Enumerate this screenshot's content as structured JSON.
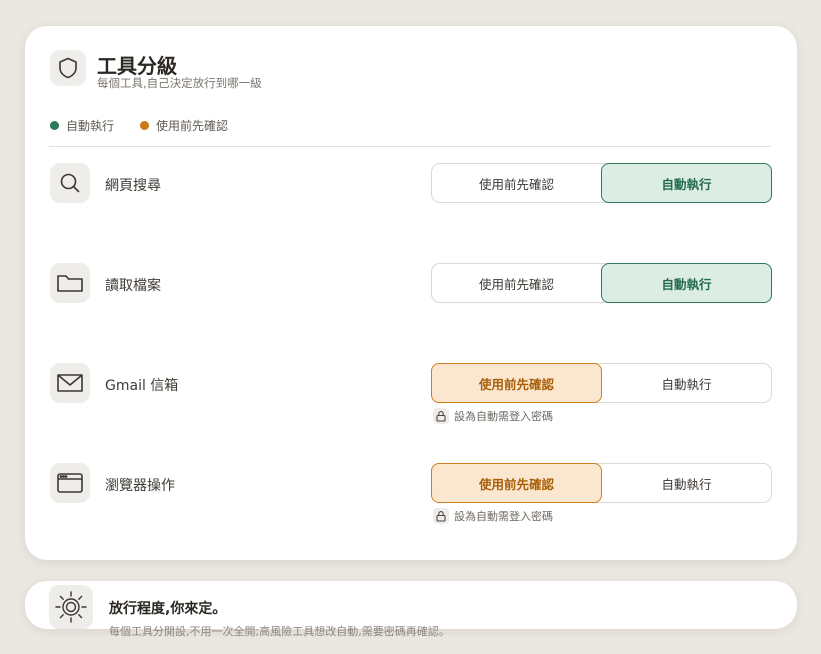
{
  "header": {
    "title": "工具分級",
    "subtitle": "每個工具,自己決定放行到哪一級",
    "icon": "shield-icon"
  },
  "legend": [
    {
      "label": "自動執行",
      "color": "#2c7a58"
    },
    {
      "label": "使用前先確認",
      "color": "#c77a15"
    }
  ],
  "tools": [
    {
      "icon": "search-icon",
      "label": "網頁搜尋",
      "confirm_label": "使用前先確認",
      "auto_label": "自動執行",
      "selected": "auto",
      "note": ""
    },
    {
      "icon": "folder-icon",
      "label": "讀取檔案",
      "confirm_label": "使用前先確認",
      "auto_label": "自動執行",
      "selected": "auto",
      "note": ""
    },
    {
      "icon": "mail-icon",
      "label": "Gmail 信箱",
      "confirm_label": "使用前先確認",
      "auto_label": "自動執行",
      "selected": "confirm",
      "note": "設為自動需登入密碼"
    },
    {
      "icon": "browser-icon",
      "label": "瀏覽器操作",
      "confirm_label": "使用前先確認",
      "auto_label": "自動執行",
      "selected": "confirm",
      "note": "設為自動需登入密碼"
    }
  ],
  "footer": {
    "icon": "sun-icon",
    "title": "放行程度,你來定。",
    "description": "每個工具分開設,不用一次全開;高風險工具想改自動,需要密碼再確認。"
  },
  "colors": {
    "auto": "#2c7a58",
    "confirm": "#c77a15"
  }
}
